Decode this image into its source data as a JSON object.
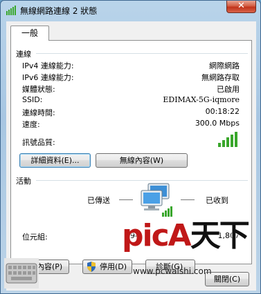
{
  "window": {
    "title": "無線網路連線 2 狀態",
    "close_glyph": "✕"
  },
  "tabs": [
    {
      "label": "一般"
    }
  ],
  "connection": {
    "heading": "連線",
    "rows": [
      {
        "label": "IPv4 連線能力:",
        "value": "網際網路"
      },
      {
        "label": "IPv6 連線能力:",
        "value": "無網路存取"
      },
      {
        "label": "媒體狀態:",
        "value": "已啟用"
      },
      {
        "label": "SSID:",
        "value": "EDIMAX-5G-iqmore"
      },
      {
        "label": "連線時間:",
        "value": "00:18:22"
      },
      {
        "label": "速度:",
        "value": "300.0 Mbps"
      }
    ],
    "signal_label": "訊號品質:",
    "signal_bars_filled": 5,
    "signal_bars_total": 5,
    "details_button": "詳細資料(E)...",
    "wireless_props_button": "無線內容(W)"
  },
  "activity": {
    "heading": "活動",
    "sent_label": "已傳送",
    "received_label": "已收到",
    "bytes_label": "位元組:",
    "bytes_sent": "894",
    "bytes_received": "1,807"
  },
  "bottom_buttons": {
    "properties": "內容(P)",
    "disable": "停用(D)",
    "diagnose": "診斷(G)"
  },
  "close_button": "關閉(C)",
  "watermark": {
    "logo_part1": "picA",
    "logo_part2": "天下",
    "url": "www.pcwaishi.com"
  },
  "colors": {
    "signal_green": "#3aa72c",
    "title_close_red": "#c1341b"
  },
  "icons": {
    "title": "network-icon",
    "activity": "network-computers-icon",
    "shield": "uac-shield-icon"
  }
}
